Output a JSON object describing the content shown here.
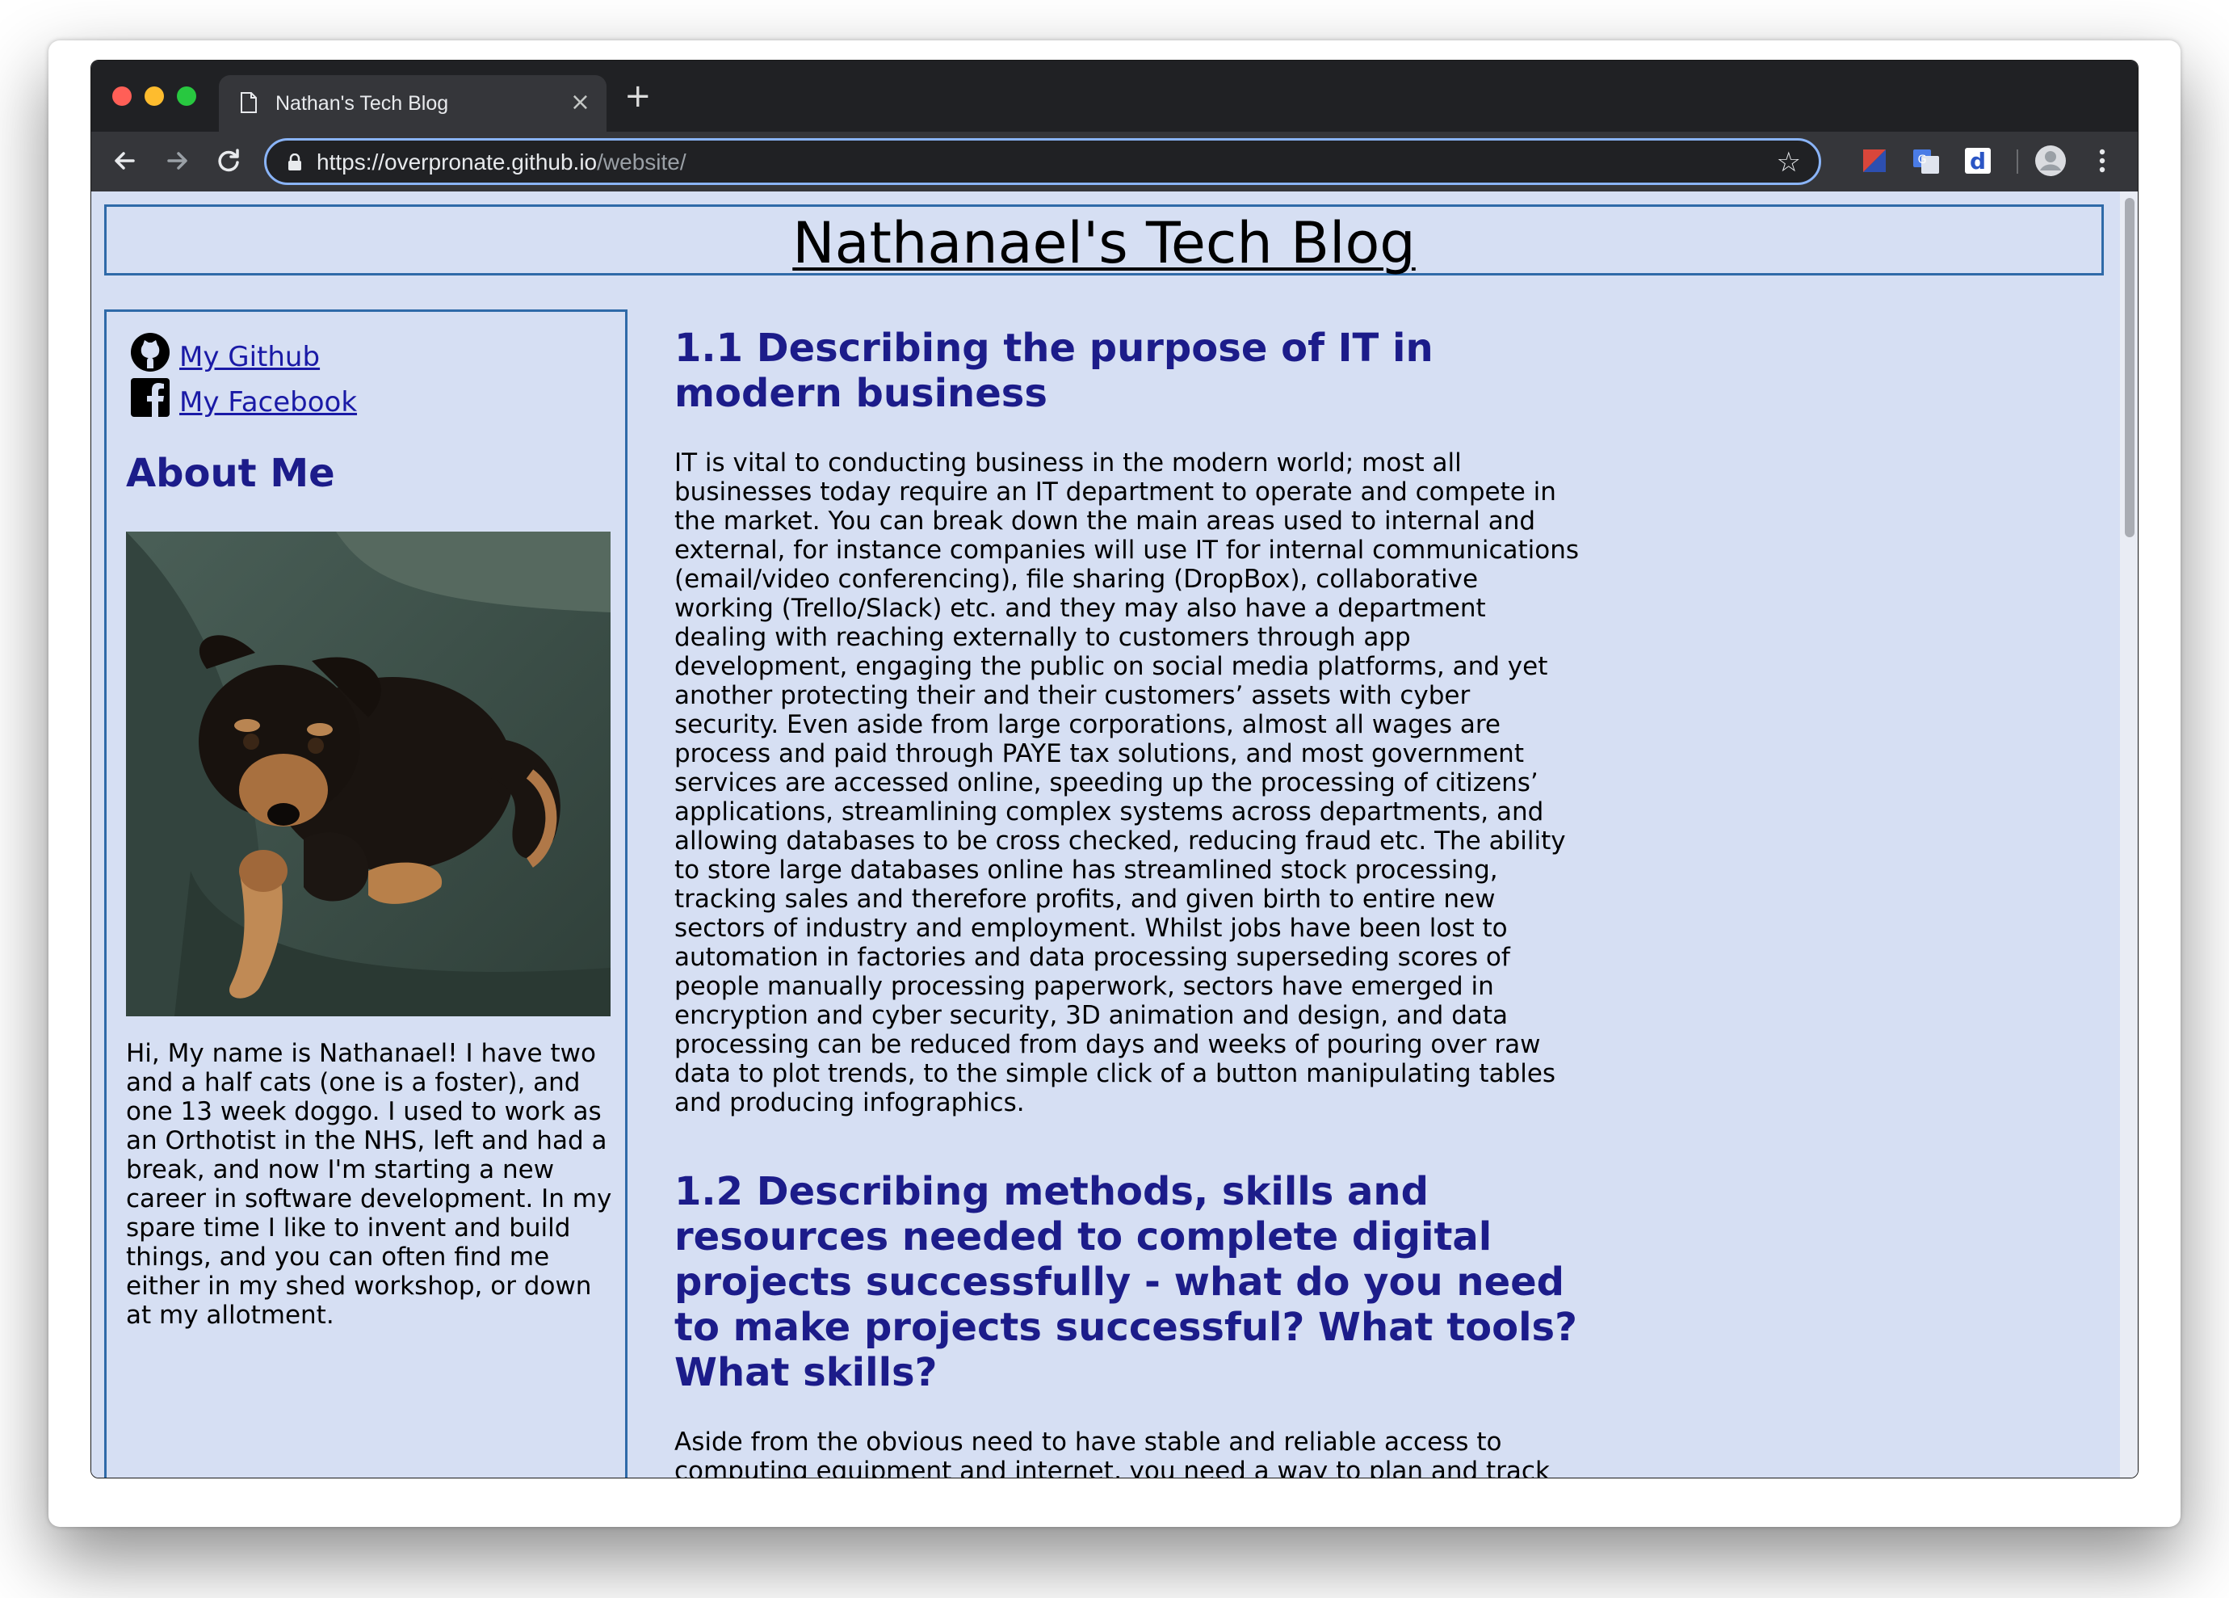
{
  "browser": {
    "tab_title": "Nathan's Tech Blog",
    "tab_close": "×",
    "new_tab": "+",
    "url_host": "https://overpronate.github.io",
    "url_path": "/website/",
    "bookmark_icon": "☆"
  },
  "header": {
    "site_title": "Nathanael's Tech Blog"
  },
  "sidebar": {
    "github_link": "My Github",
    "facebook_link": "My Facebook",
    "about_title": "About Me",
    "about_text": "Hi, My name is Nathanael! I have two and a half cats (one is a foster), and one 13 week doggo. I used to work as an Orthotist in the NHS, left and had a break, and now I'm starting a new career in software development. In my spare time I like to invent and build things, and you can often find me either in my shed workshop, or down at my allotment."
  },
  "posts": [
    {
      "title": "1.1 Describing the purpose of IT in modern business",
      "body": "IT is vital to conducting business in the modern world; most all businesses today require an IT department to operate and compete in the market. You can break down the main areas used to internal and external, for instance companies will use IT for internal communications (email/video conferencing), file sharing (DropBox), collaborative working (Trello/Slack) etc. and they may also have a department dealing with reaching externally to customers through app development, engaging the public on social media platforms, and yet another protecting their and their customers’ assets with cyber security. Even aside from large corporations, almost all wages are process and paid through PAYE tax solutions, and most government services are accessed online, speeding up the processing of citizens’ applications, streamlining complex systems across departments, and allowing databases to be cross checked, reducing fraud etc. The ability to store large databases online has streamlined stock processing, tracking sales and therefore profits, and given birth to entire new sectors of industry and employment. Whilst jobs have been lost to automation in factories and data processing superseding scores of people manually processing paperwork, sectors have emerged in encryption and cyber security, 3D animation and design, and data processing can be reduced from days and weeks of pouring over raw data to plot trends, to the simple click of a button manipulating tables and producing infographics."
    },
    {
      "title": "1.2 Describing methods, skills and resources needed to complete digital projects successfully - what do you need to make projects successful? What tools? What skills?",
      "body": "Aside from the obvious need to have stable and reliable access to computing equipment and internet, you need a way to plan and track the progress of your project, and if in a team communicating with your colleagues. Successfully working as a team can be made much easier"
    }
  ],
  "colors": {
    "page_bg": "#d6dff3",
    "border": "#2f6aa8",
    "heading": "#1c1c8a",
    "link": "#1a1aa6"
  },
  "icons": [
    "github-icon",
    "facebook-icon",
    "back-arrow-icon",
    "forward-arrow-icon",
    "reload-icon",
    "lock-icon",
    "star-icon",
    "profile-icon",
    "menu-icon"
  ]
}
